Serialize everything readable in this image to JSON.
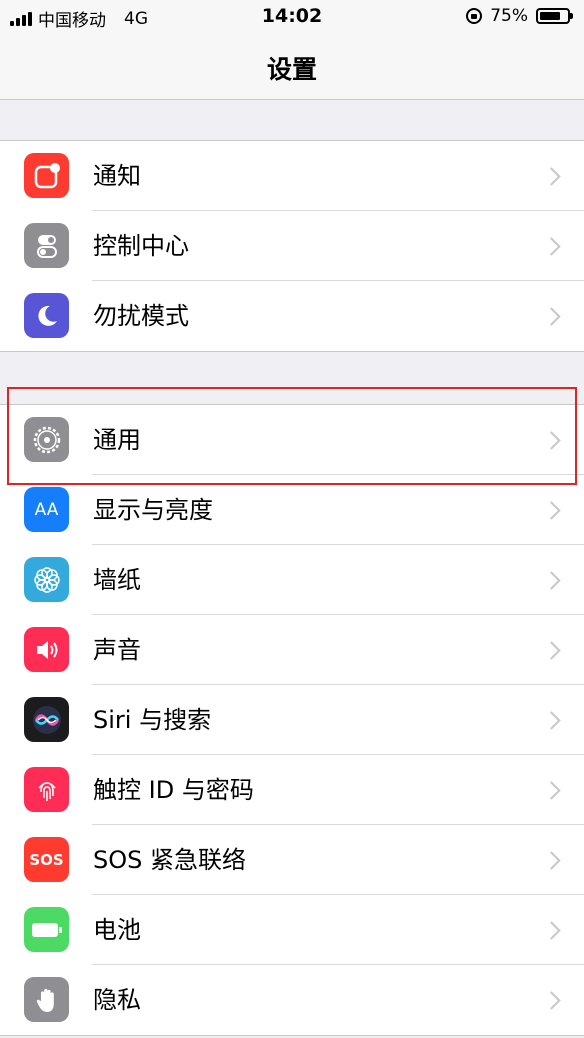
{
  "status_bar": {
    "carrier": "中国移动",
    "network": "4G",
    "time": "14:02",
    "battery": "75%"
  },
  "nav": {
    "title": "设置"
  },
  "groups": [
    {
      "items": [
        {
          "label": "通知",
          "icon": "notifications-icon",
          "color": "#fd3b30"
        },
        {
          "label": "控制中心",
          "icon": "control-center-icon",
          "color": "#8e8e93"
        },
        {
          "label": "勿扰模式",
          "icon": "moon-icon",
          "color": "#5856d6"
        }
      ]
    },
    {
      "items": [
        {
          "label": "通用",
          "icon": "gear-icon",
          "color": "#8e8e93",
          "highlighted": true
        },
        {
          "label": "显示与亮度",
          "icon": "display-icon",
          "color": "#147efb",
          "icon_text": "AA"
        },
        {
          "label": "墙纸",
          "icon": "wallpaper-icon",
          "color": "#34aadc"
        },
        {
          "label": "声音",
          "icon": "speaker-icon",
          "color": "#ff2d55"
        },
        {
          "label": "Siri 与搜索",
          "icon": "siri-icon",
          "color": "#1c1c1e"
        },
        {
          "label": "触控 ID 与密码",
          "icon": "fingerprint-icon",
          "color": "#ff2d55"
        },
        {
          "label": "SOS 紧急联络",
          "icon": "sos-icon",
          "color": "#ff3b30",
          "icon_text": "SOS"
        },
        {
          "label": "电池",
          "icon": "battery-icon",
          "color": "#4cd964"
        },
        {
          "label": "隐私",
          "icon": "hand-icon",
          "color": "#8e8e93"
        }
      ]
    }
  ],
  "annotation": {
    "color": "#e02424"
  }
}
